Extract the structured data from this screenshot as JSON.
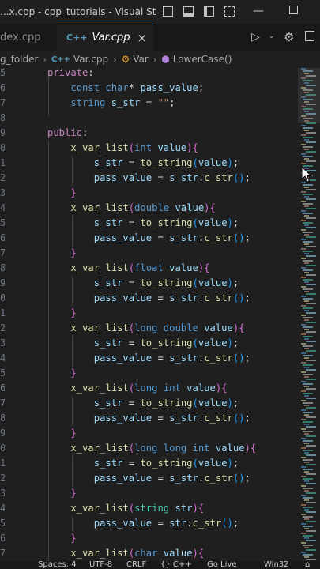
{
  "window": {
    "title": "...x.cpp - cpp_tutorials - Visual Studi..."
  },
  "tabs": [
    {
      "label": "dex.cpp",
      "active": false
    },
    {
      "label": "Var.cpp",
      "active": true,
      "close": "×"
    }
  ],
  "breadcrumb": {
    "folder": "g_folder",
    "file": "Var.cpp",
    "class": "Var",
    "method": "LowerCase()"
  },
  "statusbar": {
    "spaces": "Spaces: 4",
    "encoding": "UTF-8",
    "eol": "CRLF",
    "language": "{} C++",
    "golive": "Go Live",
    "platform": "Win32"
  },
  "code_lines": [
    "private:",
    "    const char* pass_value;",
    "    string s_str = \"\";",
    "",
    "public:",
    "    x_var_list(int value){",
    "        s_str = to_string(value);",
    "        pass_value = s_str.c_str();",
    "    }",
    "    x_var_list(double value){",
    "        s_str = to_string(value);",
    "        pass_value = s_str.c_str();",
    "    }",
    "    x_var_list(float value){",
    "        s_str = to_string(value);",
    "        pass_value = s_str.c_str();",
    "    }",
    "    x_var_list(long double value){",
    "        s_str = to_string(value);",
    "        pass_value = s_str.c_str();",
    "    }",
    "    x_var_list(long int value){",
    "        s_str = to_string(value);",
    "        pass_value = s_str.c_str();",
    "    }",
    "    x_var_list(long long int value){",
    "        s_str = to_string(value);",
    "        pass_value = s_str.c_str();",
    "    }",
    "    x_var_list(string str){",
    "        pass_value = str.c_str();",
    "    }",
    "    x_var_list(char value){"
  ],
  "line_number_fragments": [
    "5",
    "6",
    "7",
    "8",
    "9",
    "0",
    "1",
    "2",
    "3",
    "4",
    "5",
    "6",
    "7",
    "8",
    "9",
    "0",
    "1",
    "2",
    "3",
    "4",
    "5",
    "6",
    "7",
    "8",
    "9",
    "0",
    "1",
    "2",
    "3",
    "4",
    "5",
    "6",
    "7"
  ],
  "icons": [
    "split-editor-icon",
    "toggle-panel-icon",
    "toggle-sidebar-icon",
    "customize-layout-icon",
    "minimize-icon",
    "maximize-icon",
    "run-icon",
    "settings-icon",
    "split-right-icon",
    "cpp-file-icon",
    "mouse-pointer-icon"
  ]
}
